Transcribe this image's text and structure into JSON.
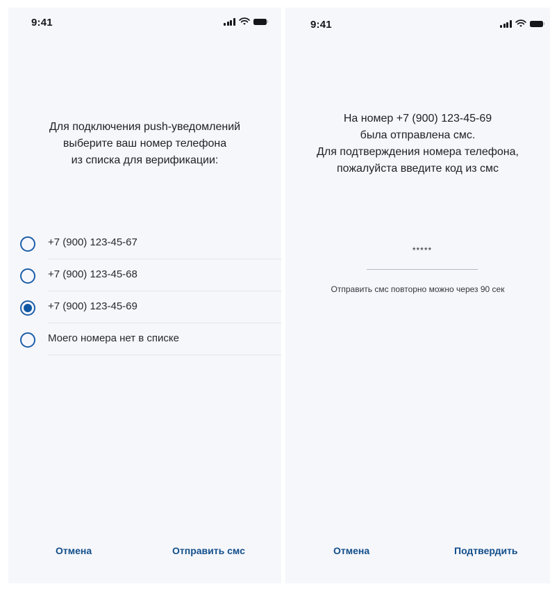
{
  "colors": {
    "accent": "#0f57a3",
    "button_text": "#114e8a",
    "screen_background": "#f6f7fb"
  },
  "status_bar": {
    "time": "9:41",
    "icons": [
      "signal-icon",
      "wifi-icon",
      "battery-icon"
    ]
  },
  "select_phone_screen": {
    "prompt": "Для подключения push-уведомлений\nвыберите ваш номер телефона\nиз списка для верификации:",
    "options": [
      {
        "label": "+7 (900) 123-45-67",
        "selected": false
      },
      {
        "label": "+7 (900) 123-45-68",
        "selected": false
      },
      {
        "label": "+7 (900) 123-45-69",
        "selected": true
      },
      {
        "label": "Моего номера нет в списке",
        "selected": false
      }
    ],
    "cancel_label": "Отмена",
    "submit_label": "Отправить смс"
  },
  "confirm_code_screen": {
    "prompt": "На номер +7 (900) 123-45-69\nбыла отправлена смс.\nДля подтверждения номера телефона,\nпожалуйста введите код из смс",
    "code_value": "*****",
    "resend_text": "Отправить смс повторно можно через  90 сек",
    "cancel_label": "Отмена",
    "submit_label": "Подтвердить"
  }
}
